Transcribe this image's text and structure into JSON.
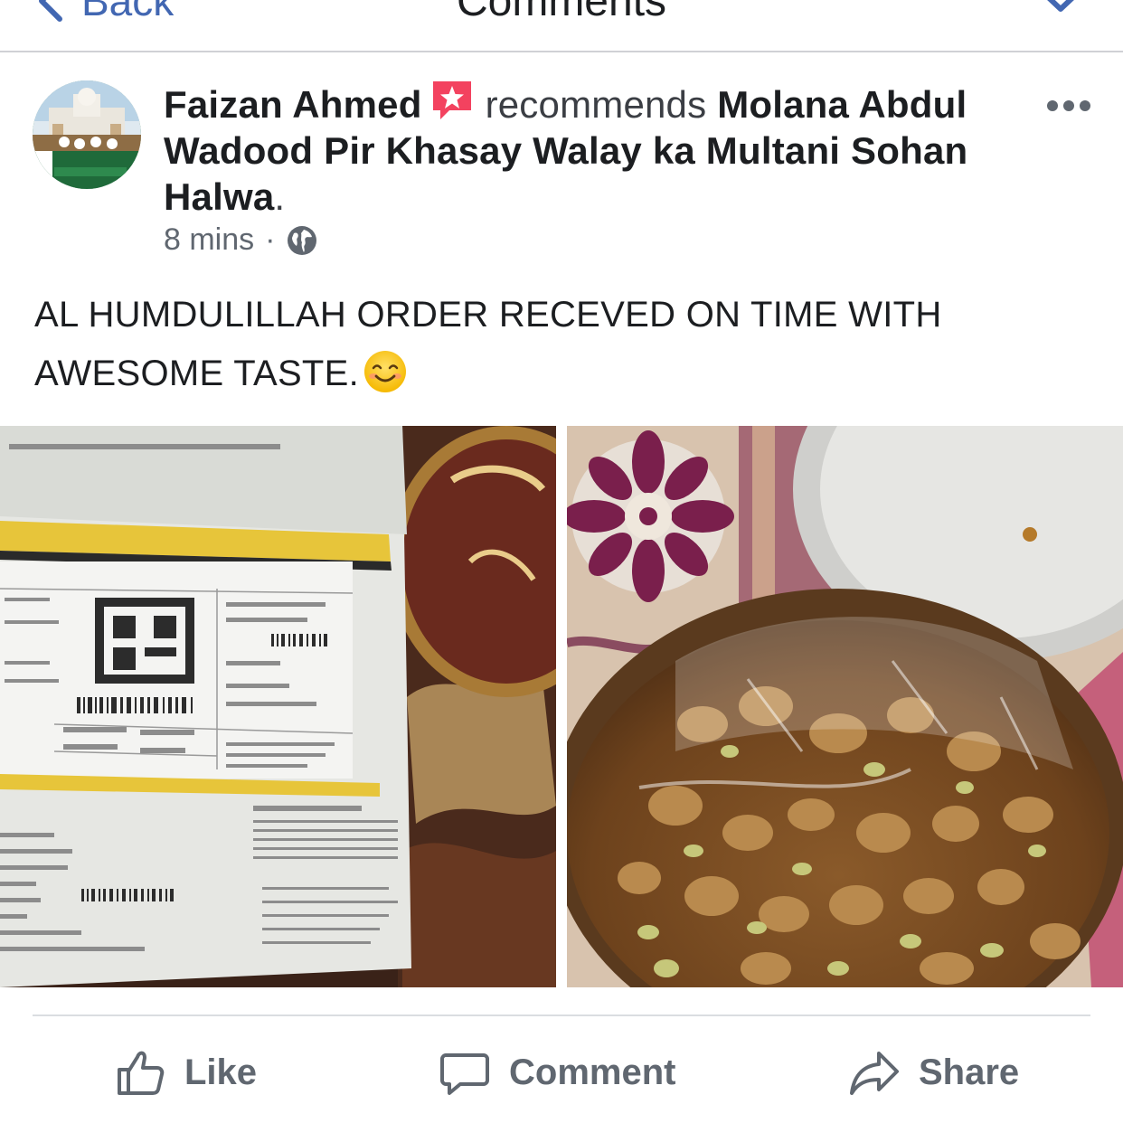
{
  "nav": {
    "back_label": "Back",
    "title": "Comments"
  },
  "post": {
    "author": "Faizan Ahmed",
    "verb": "recommends",
    "page_name": "Molana Abdul Wadood Pir Khasay Walay ka Multani Sohan Halwa",
    "page_name_suffix": ".",
    "time": "8 mins",
    "meta_separator": "·",
    "audience_icon": "globe-icon",
    "recommend_icon": "recommendation-star-icon",
    "more_icon": "more-options-icon",
    "text": "AL HUMDULILLAH ORDER RECEVED ON TIME WITH AWESOME TASTE.",
    "text_emoji": "smiling-face-emoji"
  },
  "photos": [
    {
      "name": "parcel-photo"
    },
    {
      "name": "sohan-halwa-photo"
    }
  ],
  "actions": {
    "like_label": "Like",
    "comment_label": "Comment",
    "share_label": "Share"
  },
  "colors": {
    "link_blue": "#4267b2",
    "text_dark": "#1c1e21",
    "text_gray": "#606770",
    "recommend_red": "#f3425f",
    "divider": "#dadde1"
  }
}
